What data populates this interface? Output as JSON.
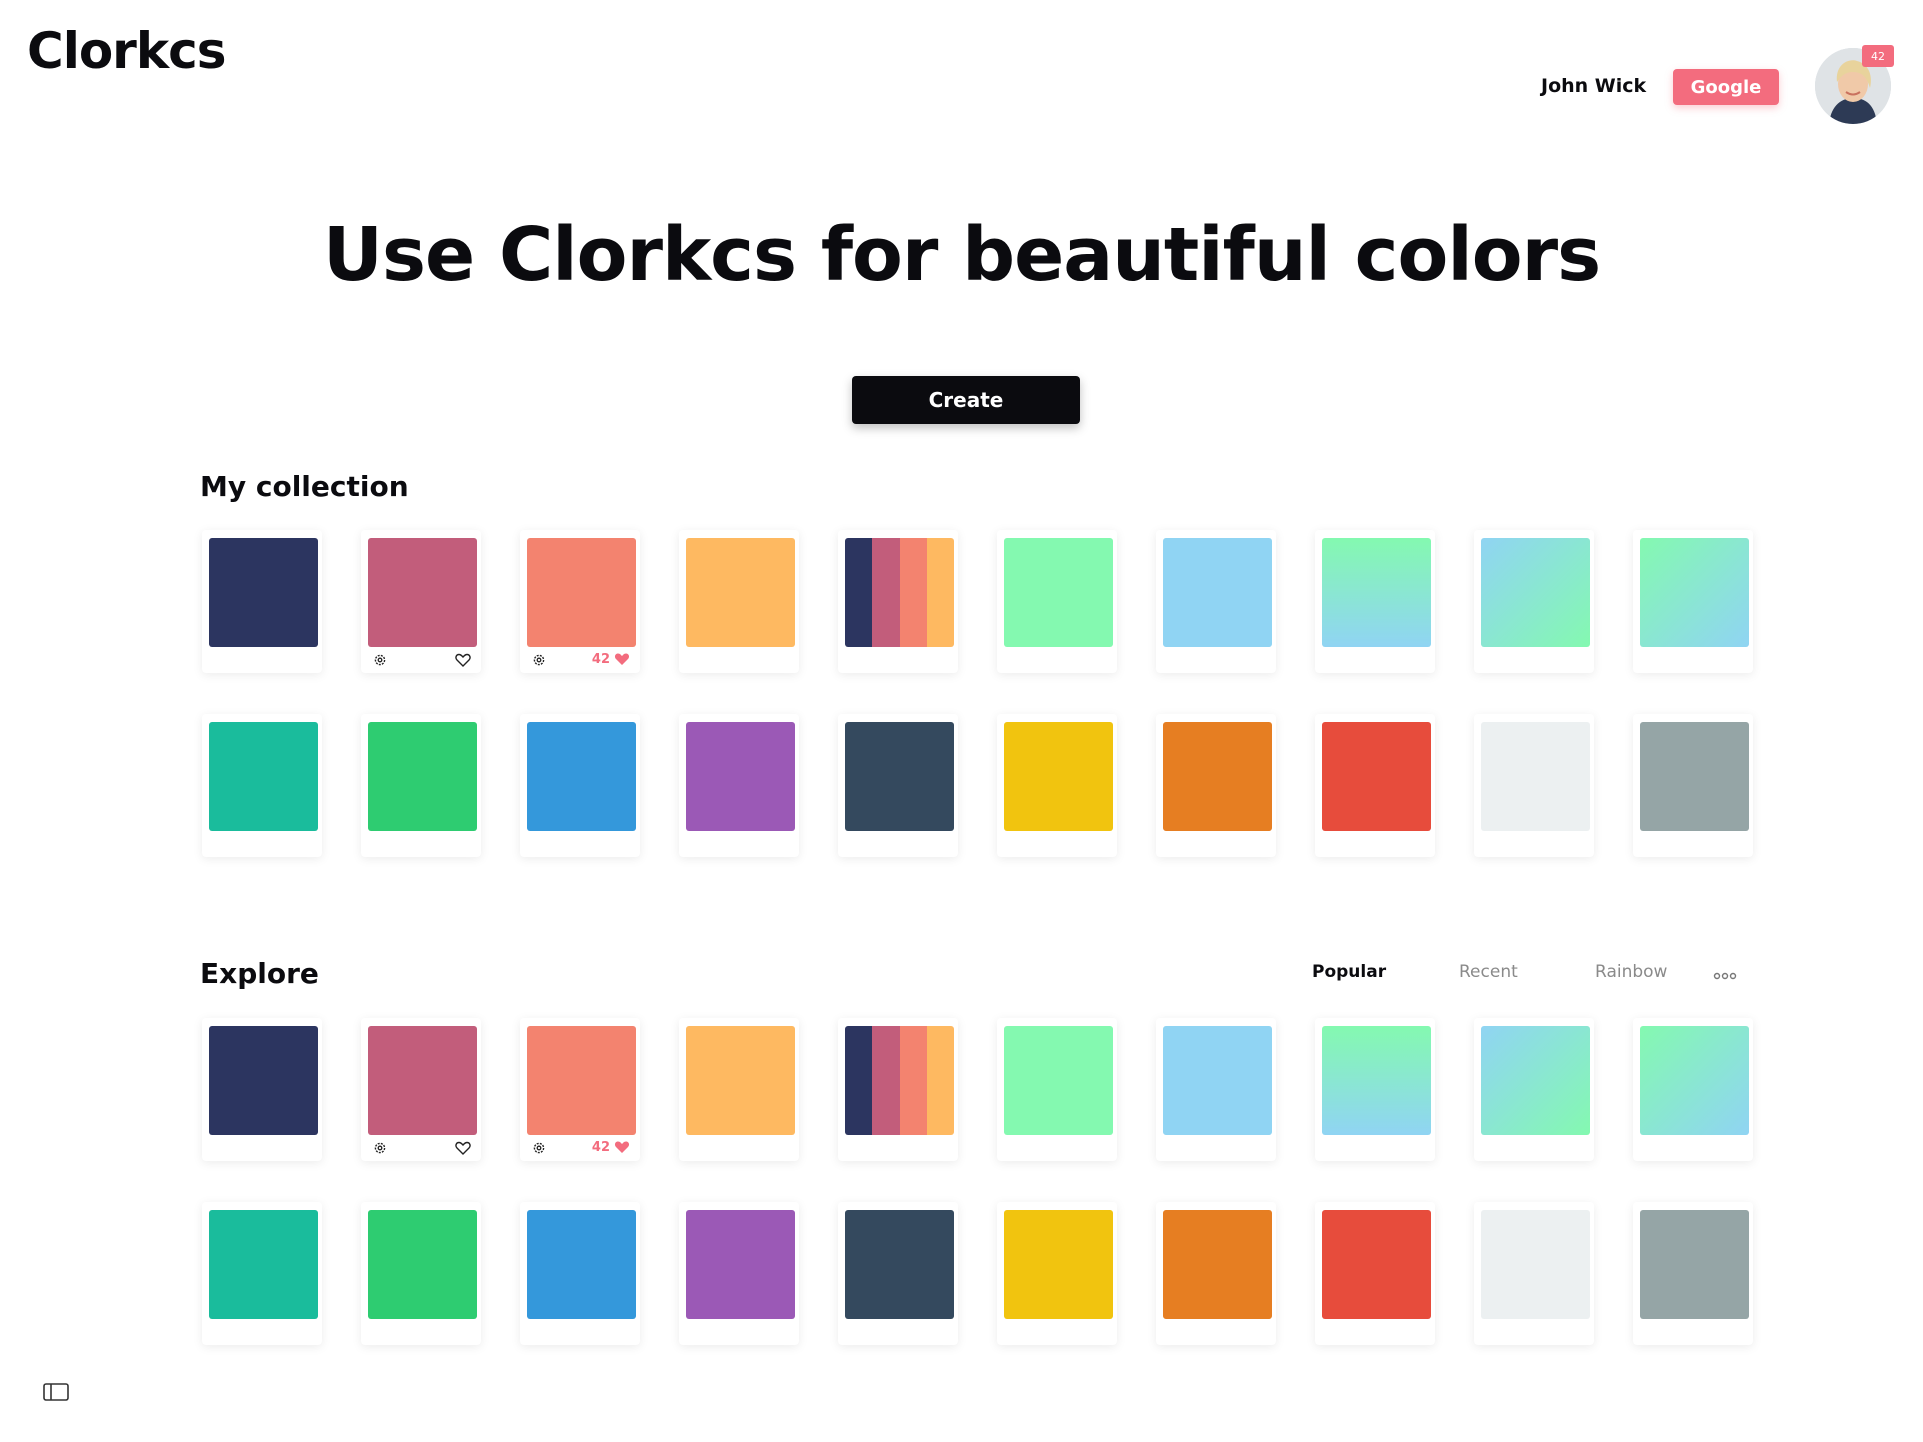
{
  "header": {
    "logo": "Clorkcs",
    "user_name": "John Wick",
    "google_label": "Google",
    "avatar_badge": "42"
  },
  "hero": {
    "title": "Use Clorkcs for beautiful colors",
    "create_label": "Create"
  },
  "collection": {
    "title": "My collection"
  },
  "explore": {
    "title": "Explore",
    "tabs": [
      {
        "label": "Popular",
        "active": true
      },
      {
        "label": "Recent",
        "active": false
      },
      {
        "label": "Rainbow",
        "active": false
      }
    ]
  },
  "palettes": [
    {
      "type": "solid",
      "colors": [
        "#2c3560"
      ]
    },
    {
      "type": "solid",
      "colors": [
        "#c25d7b"
      ],
      "footer": "settings-heart"
    },
    {
      "type": "solid",
      "colors": [
        "#f3836f"
      ],
      "footer": "settings-likes",
      "likes": "42"
    },
    {
      "type": "solid",
      "colors": [
        "#feb961"
      ]
    },
    {
      "type": "stripes",
      "colors": [
        "#2c3560",
        "#c25d7b",
        "#f3836f",
        "#feb961"
      ]
    },
    {
      "type": "solid",
      "colors": [
        "#84f9b0"
      ]
    },
    {
      "type": "solid",
      "colors": [
        "#90d4f3"
      ]
    },
    {
      "type": "gradient",
      "colors": [
        "#84f9b0",
        "#90d4f3"
      ],
      "direction": "to bottom"
    },
    {
      "type": "gradient",
      "colors": [
        "#90d4f3",
        "#84f9b0"
      ],
      "direction": "to bottom right"
    },
    {
      "type": "gradient",
      "colors": [
        "#84f9b0",
        "#90d4f3"
      ],
      "direction": "to bottom right"
    },
    {
      "type": "solid",
      "colors": [
        "#1abc9c"
      ]
    },
    {
      "type": "solid",
      "colors": [
        "#2ecc71"
      ]
    },
    {
      "type": "solid",
      "colors": [
        "#3498db"
      ]
    },
    {
      "type": "solid",
      "colors": [
        "#9b59b6"
      ]
    },
    {
      "type": "solid",
      "colors": [
        "#34495e"
      ]
    },
    {
      "type": "solid",
      "colors": [
        "#f1c40f"
      ]
    },
    {
      "type": "solid",
      "colors": [
        "#e67e22"
      ]
    },
    {
      "type": "solid",
      "colors": [
        "#e74c3c"
      ]
    },
    {
      "type": "solid",
      "colors": [
        "#ecf0f1"
      ]
    },
    {
      "type": "solid",
      "colors": [
        "#95a5a6"
      ]
    }
  ],
  "icons": {
    "settings": "settings-icon",
    "heart": "heart-icon",
    "more": "more-icon",
    "sidebar": "sidebar-toggle-icon"
  }
}
